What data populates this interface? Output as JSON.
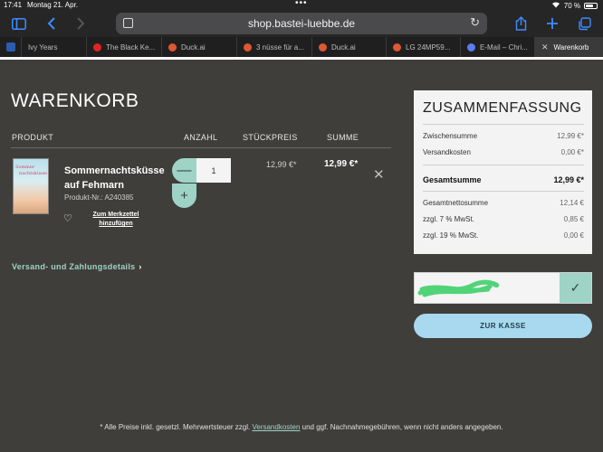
{
  "statusbar": {
    "time": "17:41",
    "date": "Montag 21. Apr.",
    "battery": "70 %",
    "battery_level": 0.7
  },
  "browser": {
    "url": "shop.bastei-luebbe.de",
    "tabs": [
      {
        "label": "Ivy Years",
        "color": "#2b6fd6"
      },
      {
        "label": "The Black Ke...",
        "color": "#e02424"
      },
      {
        "label": "Duck.ai",
        "color": "#de5833"
      },
      {
        "label": "3 nüsse für a...",
        "color": "#de5833"
      },
      {
        "label": "Duck.ai",
        "color": "#de5833"
      },
      {
        "label": "LG 24MP59...",
        "color": "#de5833"
      },
      {
        "label": "E-Mail – Chri...",
        "color": "#5b7cf0"
      },
      {
        "label": "Warenkorb",
        "color": "#9a9a9a"
      }
    ]
  },
  "cart": {
    "title": "WARENKORB",
    "columns": {
      "product": "PRODUKT",
      "quantity": "ANZAHL",
      "unit_price": "STÜCKPREIS",
      "sum": "SUMME"
    },
    "item": {
      "name": "Sommernachtsküsse auf Fehmarn",
      "product_nr": "Produkt-Nr.: A240385",
      "wishlist": "Zum Merkzettel hinzufügen",
      "quantity": "1",
      "unit_price": "12,99 €*",
      "sum": "12,99 €*"
    },
    "shipping_link": "Versand- und Zahlungsdetails"
  },
  "summary": {
    "title": "ZUSAMMENFASSUNG",
    "rows": [
      {
        "label": "Zwischensumme",
        "value": "12,99 €*"
      },
      {
        "label": "Versandkosten",
        "value": "0,00 €*"
      }
    ],
    "total": {
      "label": "Gesamtsumme",
      "value": "12,99 €*"
    },
    "tax_rows": [
      {
        "label": "Gesamtnettosumme",
        "value": "12,14 €"
      },
      {
        "label": "zzgl. 7 % MwSt.",
        "value": "0,85 €"
      },
      {
        "label": "zzgl. 19 % MwSt.",
        "value": "0,00 €"
      }
    ]
  },
  "checkout_label": "ZUR KASSE",
  "footer": {
    "before": "* Alle Preise inkl. gesetzl. Mehrwertsteuer zzgl.",
    "link": "Versandkosten",
    "after": "und ggf. Nachnahmegebühren, wenn nicht anders angegeben."
  },
  "colors": {
    "background": "#3f3e3b",
    "accent_mint": "#9ed3c6",
    "checkout_blue": "#a8d9ee"
  }
}
